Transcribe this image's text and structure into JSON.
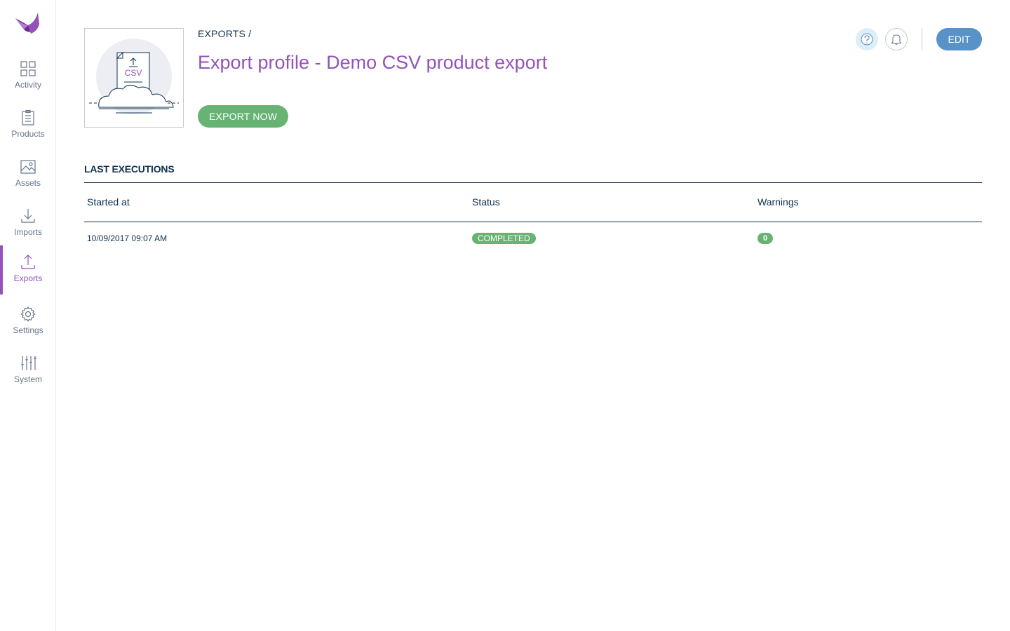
{
  "sidebar": {
    "items": [
      {
        "label": "Activity"
      },
      {
        "label": "Products"
      },
      {
        "label": "Assets"
      },
      {
        "label": "Imports"
      },
      {
        "label": "Exports"
      },
      {
        "label": "Settings"
      },
      {
        "label": "System"
      }
    ],
    "active_index": 4
  },
  "header": {
    "breadcrumb": "EXPORTS /",
    "title": "Export profile - Demo CSV product export",
    "thumbnail_text": "CSV",
    "export_now_label": "EXPORT NOW",
    "edit_label": "EDIT"
  },
  "executions": {
    "section_title": "LAST EXECUTIONS",
    "columns": [
      "Started at",
      "Status",
      "Warnings"
    ],
    "rows": [
      {
        "started_at": "10/09/2017 09:07 AM",
        "status": "COMPLETED",
        "warnings": "0"
      }
    ]
  },
  "colors": {
    "brand": "#9452ba",
    "success": "#67b373",
    "primary": "#5992c7",
    "text": "#11324d"
  }
}
